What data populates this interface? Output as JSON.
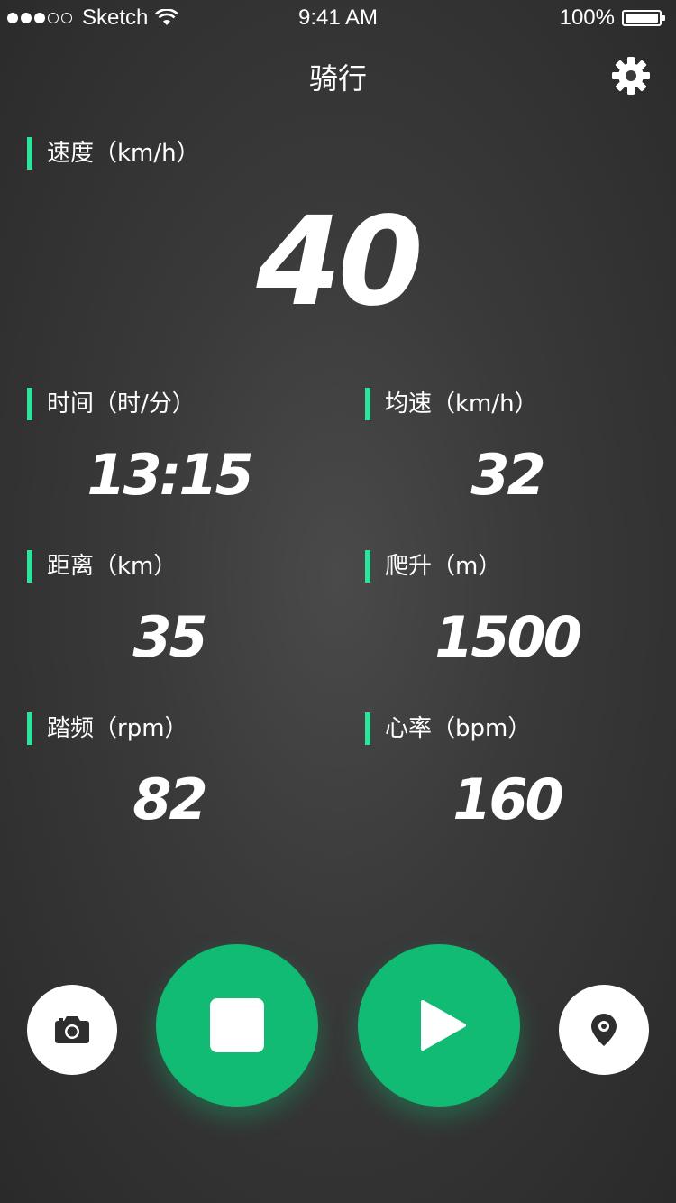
{
  "status_bar": {
    "carrier": "Sketch",
    "signal_bars_filled": 3,
    "signal_bars_total": 5,
    "time": "9:41 AM",
    "battery": "100%"
  },
  "nav": {
    "title": "骑行",
    "settings_icon": "gear-icon"
  },
  "speed": {
    "label": "速度（km/h）",
    "value": "40"
  },
  "metrics": [
    {
      "label": "时间（时/分）",
      "value": "13:15"
    },
    {
      "label": "均速（km/h）",
      "value": "32"
    },
    {
      "label": "距离（km）",
      "value": "35"
    },
    {
      "label": "爬升（m）",
      "value": "1500"
    },
    {
      "label": "踏频（rpm）",
      "value": "82"
    },
    {
      "label": "心率（bpm）",
      "value": "160"
    }
  ],
  "controls": {
    "camera_icon": "camera-icon",
    "stop_icon": "stop-icon",
    "play_icon": "play-icon",
    "location_icon": "location-pin-icon"
  },
  "colors": {
    "accent_bar": "#2ee39b",
    "primary_button": "#12bb73",
    "background": "#3a3a3a"
  }
}
